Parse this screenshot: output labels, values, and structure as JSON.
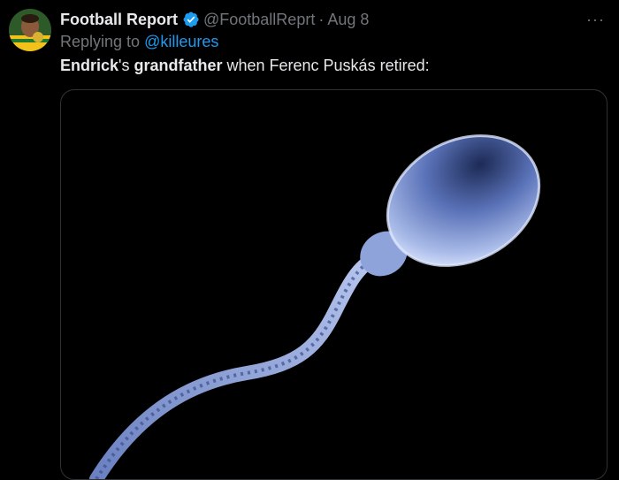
{
  "tweet": {
    "author_name": "Football Report",
    "author_handle": "@FootballReprt",
    "separator": "·",
    "date": "Aug 8",
    "more_label": "···",
    "reply_prefix": "Replying to",
    "reply_to": "@killeures",
    "text_part1": "Endrick",
    "text_part2": "'s ",
    "text_part3": "grandfather",
    "text_part4": " when Ferenc Puskás retired:"
  },
  "colors": {
    "background": "#000000",
    "primary_text": "#e7e9ea",
    "secondary_text": "#71767b",
    "link": "#1d9bf0",
    "verified_badge": "#1d9bf0",
    "media_subject": "#8fa5d8"
  },
  "icons": {
    "verified": "verified-badge-icon",
    "more": "more-options-icon"
  }
}
